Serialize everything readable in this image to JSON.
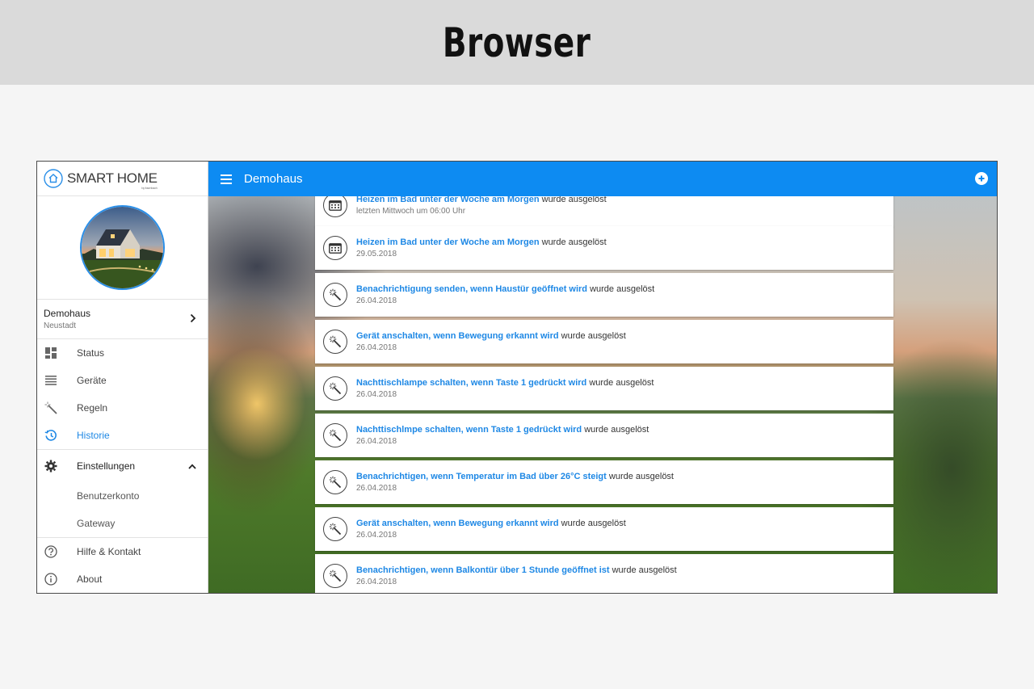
{
  "banner": {
    "title": "Browser"
  },
  "sidebar": {
    "brand": {
      "name": "SMART HOME",
      "sub": "by fosmbach"
    },
    "home": {
      "name": "Demohaus",
      "city": "Neustadt"
    },
    "nav": [
      {
        "label": "Status",
        "icon": "dashboard-icon"
      },
      {
        "label": "Geräte",
        "icon": "list-icon"
      },
      {
        "label": "Regeln",
        "icon": "magic-wand-icon"
      },
      {
        "label": "Historie",
        "icon": "history-icon",
        "active": true
      }
    ],
    "settings": {
      "label": "Einstellungen",
      "icon": "gear-icon",
      "children": [
        {
          "label": "Benutzerkonto"
        },
        {
          "label": "Gateway"
        }
      ]
    },
    "footer": [
      {
        "label": "Hilfe & Kontakt",
        "icon": "help-icon"
      },
      {
        "label": "About",
        "icon": "info-icon"
      }
    ]
  },
  "topbar": {
    "title": "Demohaus"
  },
  "history": {
    "suffix": " wurde ausgelöst",
    "items": [
      {
        "rule": "Heizen im Bad unter der Woche am Morgen",
        "date": "letzten Mittwoch um 06:00 Uhr",
        "icon": "calendar-icon"
      },
      {
        "rule": "Heizen im Bad unter der Woche am Morgen",
        "date": "29.05.2018",
        "icon": "calendar-icon"
      },
      {
        "rule": "Benachrichtigung senden, wenn Haustür geöffnet wird",
        "date": "26.04.2018",
        "icon": "magic-wand-icon"
      },
      {
        "rule": "Gerät anschalten, wenn Bewegung erkannt wird",
        "date": "26.04.2018",
        "icon": "magic-wand-icon"
      },
      {
        "rule": "Nachttischlampe schalten, wenn Taste 1 gedrückt wird",
        "date": "26.04.2018",
        "icon": "magic-wand-icon"
      },
      {
        "rule": "Nachttischlmpe schalten, wenn Taste 1 gedrückt wird",
        "date": "26.04.2018",
        "icon": "magic-wand-icon"
      },
      {
        "rule": "Benachrichtigen, wenn Temperatur im Bad über 26°C steigt",
        "date": "26.04.2018",
        "icon": "magic-wand-icon"
      },
      {
        "rule": "Gerät anschalten, wenn Bewegung erkannt wird",
        "date": "26.04.2018",
        "icon": "magic-wand-icon"
      },
      {
        "rule": "Benachrichtigen, wenn Balkontür über 1 Stunde geöffnet ist",
        "date": "26.04.2018",
        "icon": "magic-wand-icon"
      }
    ]
  },
  "colors": {
    "accent": "#0d8bf2",
    "link": "#1e88e5"
  }
}
